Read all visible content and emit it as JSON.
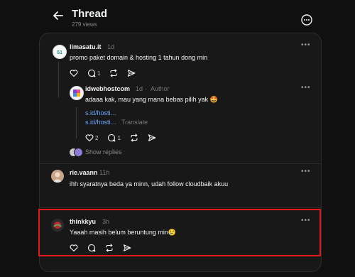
{
  "header": {
    "title": "Thread",
    "views": "279 views"
  },
  "posts": [
    {
      "username": "limasatu.it",
      "time": "1d",
      "author_tag": "",
      "text": "promo paket domain & hosting 1 tahun dong min",
      "like_count": "",
      "reply_count": "1",
      "repost_count": ""
    },
    {
      "username": "idwebhostcom",
      "time": "1d",
      "author_tag": "Author",
      "text": "adaaa kak, mau yang mana bebas pilih yak 🤩",
      "links": [
        "s.id/hosti…",
        "s.id/hosti…"
      ],
      "translate": "Translate",
      "like_count": "2",
      "reply_count": "1",
      "repost_count": ""
    },
    {
      "username": "rie.vaann",
      "time": "11h",
      "author_tag": "",
      "text": "ihh syaratnya beda ya minn, udah follow cloudbaik akuu"
    },
    {
      "username": "thinkkyu",
      "time": "3h",
      "author_tag": "",
      "text": "Yaaah masih belum beruntung min😢"
    }
  ],
  "show_replies": "Show replies",
  "colors": {
    "accent_link": "#6aa7ff",
    "highlight": "#e5171e",
    "background": "#101010",
    "card": "#181818"
  }
}
